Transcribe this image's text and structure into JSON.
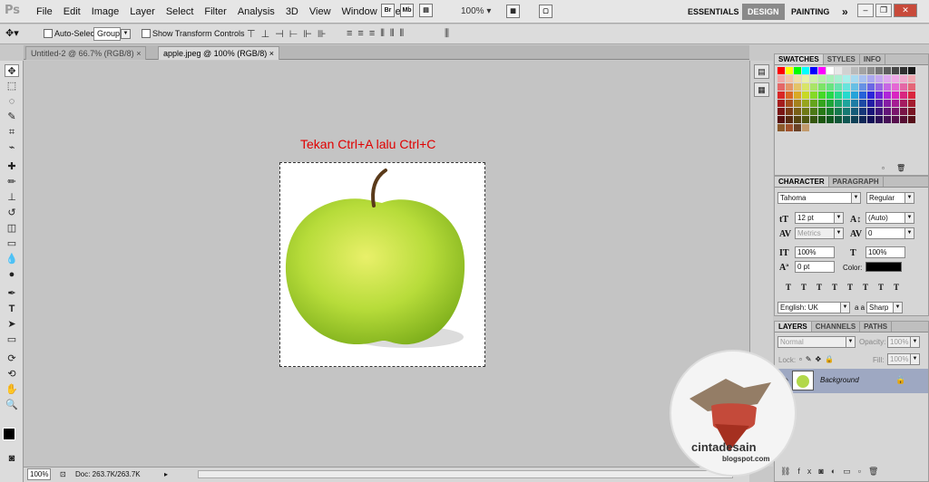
{
  "app_logo": "Ps",
  "menu": [
    "File",
    "Edit",
    "Image",
    "Layer",
    "Select",
    "Filter",
    "Analysis",
    "3D",
    "View",
    "Window",
    "Help"
  ],
  "menubar_icons": [
    "Br",
    "Mb"
  ],
  "zoom_menu": "100%",
  "workspaces": [
    "ESSENTIALS",
    "DESIGN",
    "PAINTING"
  ],
  "workspace_more": "»",
  "options": {
    "auto_select_label": "Auto-Select:",
    "auto_select_value": "Group",
    "show_transform_label": "Show Transform Controls"
  },
  "doc_tabs": [
    {
      "label": "Untitled-2 @ 66.7% (RGB/8)",
      "close": "×"
    },
    {
      "label": "apple.jpeg @ 100% (RGB/8)",
      "close": "×"
    }
  ],
  "canvas_hint": "Tekan Ctrl+A lalu Ctrl+C",
  "status": {
    "zoom": "100%",
    "doc": "Doc: 263.7K/263.7K"
  },
  "swatches": {
    "tabs": [
      "SWATCHES",
      "STYLES",
      "INFO"
    ]
  },
  "character": {
    "tabs": [
      "CHARACTER",
      "PARAGRAPH"
    ],
    "font": "Tahoma",
    "style": "Regular",
    "size": "12 pt",
    "leading": "(Auto)",
    "kerning": "Metrics",
    "tracking": "0",
    "vscale": "100%",
    "hscale": "100%",
    "baseline": "0 pt",
    "color_label": "Color:",
    "language": "English: UK",
    "antialias_glyph": "a a",
    "antialias": "Sharp",
    "color": "#000000"
  },
  "layers": {
    "tabs": [
      "LAYERS",
      "CHANNELS",
      "PATHS"
    ],
    "blend": "Normal",
    "opacity_label": "Opacity:",
    "opacity": "100%",
    "lock_label": "Lock:",
    "fill_label": "Fill:",
    "fill": "100%",
    "layer_name": "Background"
  },
  "watermark": {
    "brand": "cintadesain",
    "site": "blogspot.com"
  }
}
